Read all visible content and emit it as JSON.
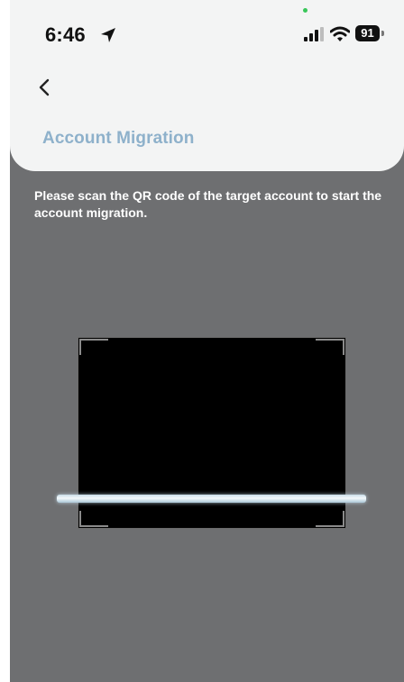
{
  "status_bar": {
    "time": "6:46",
    "battery": "91",
    "icons": [
      "location-arrow-icon",
      "cellular-signal-icon",
      "wifi-icon",
      "battery-icon"
    ]
  },
  "header": {
    "back_icon": "chevron-left-icon",
    "title": "Account Migration"
  },
  "main": {
    "instruction": "Please scan the QR code of the target account to start the account migration."
  },
  "colors": {
    "title": "#8eb1cb",
    "background_overlay": "#6e6f71",
    "panel": "#f3f4f4",
    "scan_line": "#c9dde8"
  }
}
